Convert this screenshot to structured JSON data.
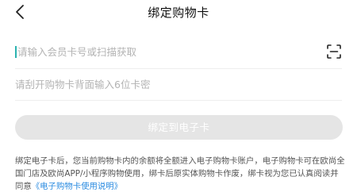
{
  "header": {
    "title": "绑定购物卡",
    "back_icon": "chevron-left-icon"
  },
  "form": {
    "card_number": {
      "value": "",
      "placeholder": "请输入会员卡号或扫描获取",
      "scan_icon": "scan-icon"
    },
    "card_pin": {
      "value": "",
      "placeholder": "请刮开购物卡背面输入6位卡密"
    }
  },
  "bind_button": {
    "label": "绑定到电子卡",
    "state": "disabled"
  },
  "notice": {
    "text": "绑定电子卡后，您当前购物卡内的余额将全额进入电子购物卡账户，电子购物卡可在欧尚全国门店及欧尚APP/小程序购物使用，绑卡后原实体购物卡作废，绑卡视为您已认真阅读并同意",
    "link_text": "《电子购物卡使用说明》"
  },
  "colors": {
    "accent": "#2bb3b0",
    "link": "#2a8be0",
    "button_disabled_bg": "#e5e5e5",
    "placeholder": "#b3b3b3"
  }
}
